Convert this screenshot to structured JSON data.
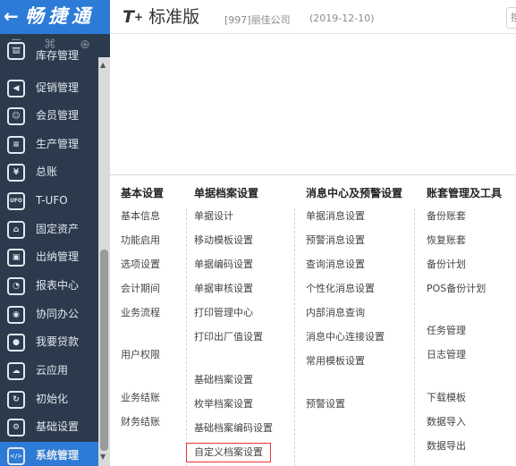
{
  "sidebar": {
    "brand_arrow": "←",
    "brand_name": "畅捷通",
    "tool_icons": [
      "menu-icon",
      "bookmark-icon",
      "add-icon"
    ],
    "tool_glyphs": [
      "☰",
      "⌘",
      "⊕"
    ],
    "items": [
      {
        "label": "库存管理",
        "icon": "inventory-icon",
        "glyph": "▤"
      },
      {
        "label": "促销管理",
        "icon": "promotion-icon",
        "glyph": "◀"
      },
      {
        "label": "会员管理",
        "icon": "member-icon",
        "glyph": "☺"
      },
      {
        "label": "生产管理",
        "icon": "production-icon",
        "glyph": "≡"
      },
      {
        "label": "总账",
        "icon": "ledger-icon",
        "glyph": "¥"
      },
      {
        "label": "T-UFO",
        "icon": "ufo-icon",
        "glyph": "UFO"
      },
      {
        "label": "固定资产",
        "icon": "fixed-assets-icon",
        "glyph": "⌂"
      },
      {
        "label": "出纳管理",
        "icon": "cashier-icon",
        "glyph": "▣"
      },
      {
        "label": "报表中心",
        "icon": "report-icon",
        "glyph": "◔"
      },
      {
        "label": "协同办公",
        "icon": "collaboration-icon",
        "glyph": "◉"
      },
      {
        "label": "我要贷款",
        "icon": "loan-icon",
        "glyph": "●"
      },
      {
        "label": "云应用",
        "icon": "cloud-icon",
        "glyph": "☁"
      },
      {
        "label": "初始化",
        "icon": "initialize-icon",
        "glyph": "↻"
      },
      {
        "label": "基础设置",
        "icon": "basic-settings-icon",
        "glyph": "⚙"
      },
      {
        "label": "系统管理",
        "icon": "system-management-icon",
        "glyph": "</>"
      }
    ]
  },
  "topbar": {
    "logo_t": "T",
    "logo_plus": "+",
    "logo_text": "标准版",
    "company": "[997]丽佳公司",
    "date": "(2019-12-10)",
    "search_glyph": "搜"
  },
  "panel": {
    "columns": [
      {
        "header": "基本设置",
        "items": [
          "基本信息",
          "功能启用",
          "选项设置",
          "会计期间",
          "业务流程",
          "用户权限",
          "业务结账",
          "财务结账"
        ]
      },
      {
        "header": "单据档案设置",
        "items": [
          "单据设计",
          "移动模板设置",
          "单据编码设置",
          "单据审核设置",
          "打印管理中心",
          "打印出厂值设置",
          "基础档案设置",
          "枚举档案设置",
          "基础档案编码设置",
          "自定义档案设置"
        ]
      },
      {
        "header": "消息中心及预警设置",
        "items": [
          "单据消息设置",
          "预警消息设置",
          "查询消息设置",
          "个性化消息设置",
          "内部消息查询",
          "消息中心连接设置",
          "常用模板设置",
          "预警设置"
        ]
      },
      {
        "header": "账套管理及工具",
        "items": [
          "备份账套",
          "恢复账套",
          "备份计划",
          "POS备份计划",
          "任务管理",
          "日志管理",
          "下载模板",
          "数据导入",
          "数据导出"
        ]
      }
    ]
  },
  "colors": {
    "sidebar_bg": "#2b3a4c",
    "accent": "#2d7bd7",
    "highlight_border": "#ee3333"
  }
}
